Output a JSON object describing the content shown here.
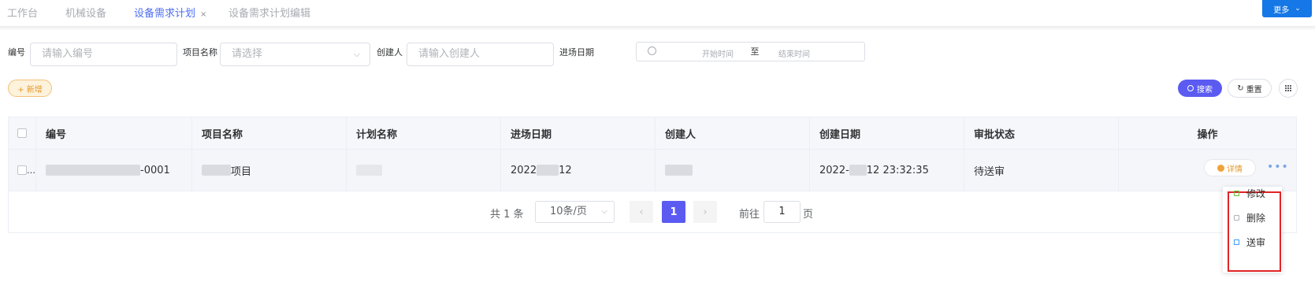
{
  "tabs": [
    {
      "label": "工作台"
    },
    {
      "label": "机械设备"
    },
    {
      "label": "设备需求计划",
      "close": "×"
    },
    {
      "label": "设备需求计划编辑"
    }
  ],
  "more_button": {
    "label": "更多",
    "chevron": "⌄"
  },
  "filters": {
    "code": {
      "label": "编号",
      "placeholder": "请输入编号"
    },
    "project": {
      "label": "项目名称",
      "placeholder": "请选择",
      "arrow": "⌵"
    },
    "creator": {
      "label": "创建人",
      "placeholder": "请输入创建人"
    },
    "date": {
      "label": "进场日期",
      "start_placeholder": "开始时间",
      "separator": "至",
      "end_placeholder": "结束时间"
    }
  },
  "toolbar": {
    "add_label": "+ 新增",
    "search_label": "搜索",
    "reset_label": "重置",
    "reset_icon": "↻"
  },
  "table": {
    "columns": [
      "编号",
      "项目名称",
      "计划名称",
      "进场日期",
      "创建人",
      "创建日期",
      "审批状态",
      "操作"
    ],
    "rows": [
      {
        "code_suffix": "-0001",
        "project_suffix": "项目",
        "entry_date_prefix": "2022",
        "entry_date_suffix": "12",
        "created_prefix": "2022-",
        "created_suffix": "12 23:32:35",
        "status": "待送审",
        "row_ellipsis": "…",
        "detail_label": "详情",
        "more_dots": "•••"
      }
    ]
  },
  "pagination": {
    "total": "共 1 条",
    "page_size": "10条/页",
    "prev": "‹",
    "current": "1",
    "next": "›",
    "goto_label": "前往",
    "goto_value": "1",
    "page_label": "页"
  },
  "action_menu": {
    "items": [
      {
        "label": "修改",
        "icon": "edit-icon"
      },
      {
        "label": "删除",
        "icon": "delete-icon"
      },
      {
        "label": "送审",
        "icon": "submit-icon"
      }
    ],
    "highlight_color": "#e02424"
  },
  "colors": {
    "accent": "#5b5bf2",
    "brand_blue": "#1677e6",
    "warning": "#e6982b"
  }
}
